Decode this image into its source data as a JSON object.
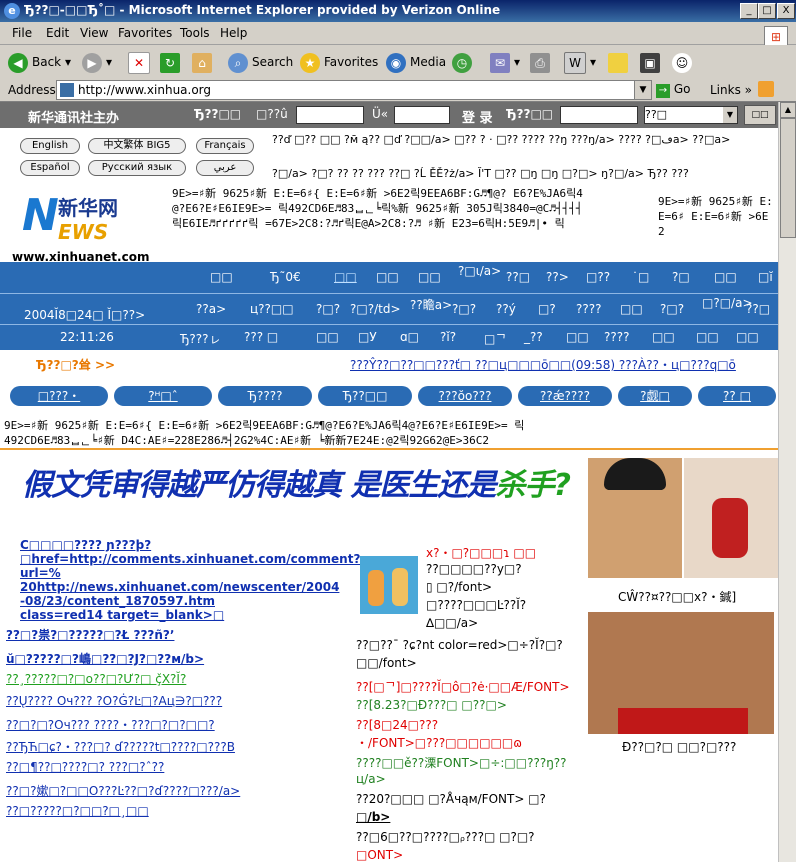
{
  "window": {
    "title": "Ђ??□-□□Ђ˚□ - Microsoft Internet Explorer provided by Verizon Online",
    "min_label": "_",
    "max_label": "□",
    "close_label": "X"
  },
  "menu": [
    "File",
    "Edit",
    "View",
    "Favorites",
    "Tools",
    "Help"
  ],
  "toolbar": {
    "back": "Back",
    "search": "Search",
    "favorites": "Favorites",
    "media": "Media"
  },
  "address": {
    "label": "Address",
    "url": "http://www.xinhua.org",
    "go": "Go",
    "links": "Links"
  },
  "site": {
    "agency": "新华通讯社主办",
    "login": "登 录",
    "search_field": "??□",
    "top_field1": "Ђ??□□",
    "top_field2": "□??û",
    "top_field3": "Ü«",
    "top_field4": "Ђ??□□",
    "lang": [
      "English",
      "中文繁体 BIG5",
      "Français",
      "Español",
      "Русский язык",
      "عربي"
    ],
    "lang_links_line1": "??ď □?? □□ ?м̄ ą?? □ď ?□□/a> □?? ? · □?? ???? ??ŋ ???ŋ/a> ???? ?□ڡa> ??□a>",
    "lang_links_line2": "?□/a> ?□? ?? ?? ??? ??□ ?Ĺ ĚĚ?ż/a> Ĭ'Τ □?? □ŋ □ŋ □?□> ŋ?□/a> Ђ?? ???",
    "logo_top": "新华网",
    "logo_n": "N",
    "logo_ews": "EWS",
    "logo_url": "www.xinhuanet.com",
    "logo_code": "9E>=♯新 9625♯新 E:E=6♯{ E:E=6♯新 >6E2릭9EEA6BF:G♬¶@? E6?E%JA6릭4@?E6?E♯E6IE9E>= 릭492CD6E♬83ᆸᆫ╘릭%新 9625♯新 305J릭3840=@C♬┤┤┤┤릭E6IE♬ґґґґґ릭 =67E>2C8:?♬ґ릭E@A>2C8:?♬ ♯新 E23=6릭H:5E9♬|• 릭",
    "logo_code_right": "9E>=♯新 9625♯新 E:E=6♯ E:E=6♯新 >6E2",
    "nav_row1": [
      "□□",
      "Ђ˜0€",
      "□□",
      "□□",
      "□□",
      "?□ι/a>",
      "??□",
      "??>",
      "□??",
      "˙□",
      "?□",
      "□□",
      "□ĭ"
    ],
    "nav_row2": [
      "2004Ĭ8□24□ Ĭ□??>",
      "??a>",
      "ц??□□",
      "?□?",
      "?□?/td>",
      "??瞻a>",
      "?□?",
      "??ý",
      "□?",
      "????",
      "□□",
      "?□?",
      "□?□/a>",
      "??□"
    ],
    "nav_row3": [
      "22:11:26",
      "Ђ???ㇾ",
      "??? □",
      "□□",
      "□У",
      "ɑ□",
      "?ǐ?",
      "□ᄀ",
      "_??",
      "□□",
      "????",
      "□□",
      "□□",
      "□□"
    ],
    "orange_label": "Ђ??□?耸 >>",
    "ticker": "???Ŷ??□??□□???ť□ ??□ц□□□ō□□(09:58) ???À??・ц□???q□ō",
    "pills": [
      "□???・",
      "?ᴴ□ˆ",
      "Ђ????",
      "Ђ??□□",
      "???ŏo???",
      "??ǽ????",
      "?觑□",
      "?? □"
    ],
    "garble1": "9E>=♯新 9625♯新 E:E=6♯{ E:E=6♯新 >6E2릭9EEA6BF:G♬¶@?E6?E%JA6릭4@?E6?E♯E6IE9E>= 릭",
    "garble2": "492CD6E♬83ᆸᆫ╘♯新 D4C:AE♯=228E286♬┤2G2%4C:AE♯新 ╘新新7E24E:@2릭92G62@E>36C2",
    "headline_main": "假文凭审得越严仿得越真 是医生还是",
    "headline_green": "杀手?",
    "left_items": [
      "C□□□□???? ɲ???þ?",
      "□href=http://comments.xinhuanet.com/comment?",
      "url=%",
      "20http://news.xinhuanet.com/newscenter/2004",
      "-08/23/content_1870597.htm",
      "class=red14 target=_blank>□",
      "??□?祟?□?????□?Ł ???ñ?ʼ",
      "ŭ□?????□?嶋□??□?J?□??м/b>",
      "??¸?????□?□o??□?Ư?□ ç̌X?Ĭ?",
      "??Ų????  Oч???  ?O?Ġ?Ŀ□?Aц∋?□???",
      "??□?□?Oч???  ????・???□?□?□□?",
      "??ЂЋ□ɕ?・???□? ɗ?????t□????□???B",
      "??□¶??□????□? ???□?ˆ??",
      "??□?嫰□?□□O???Ŀ??□?ɗ????□???/a>",
      "??□?????□?□□?□¸□□"
    ],
    "mid_items": [
      "x?・□?□□□ɿ □□",
      "??□□□□??y□?",
      "▯ □?/font>",
      "□????□□□Ŀ??Ĭ?",
      "∆□□/a>",
      "??□??¯ ?ɕ?nt color=red>□÷?Ĭ?□?",
      "□□/font>",
      "??[□ᄀ]□????Ĭ□ô□?ė·□□Æ/FONT>",
      "??[8.23?□Ð???□ □??□>",
      "??[8□24□???",
      "・/FONT>□???□□□□□□ɷ",
      "????□□ě??溧FONT>□÷:□□???ŋ??",
      "ц/a>",
      "??20?□□□ □?Åчąм/FONT> □?",
      "□/b>",
      "??□6□??□????□ᵨ???□ □?□?",
      "□ONT>"
    ],
    "caption1": "CŴ??¤??□□x?・鍼]",
    "caption2": "Ð??□?□ □□?□???"
  }
}
